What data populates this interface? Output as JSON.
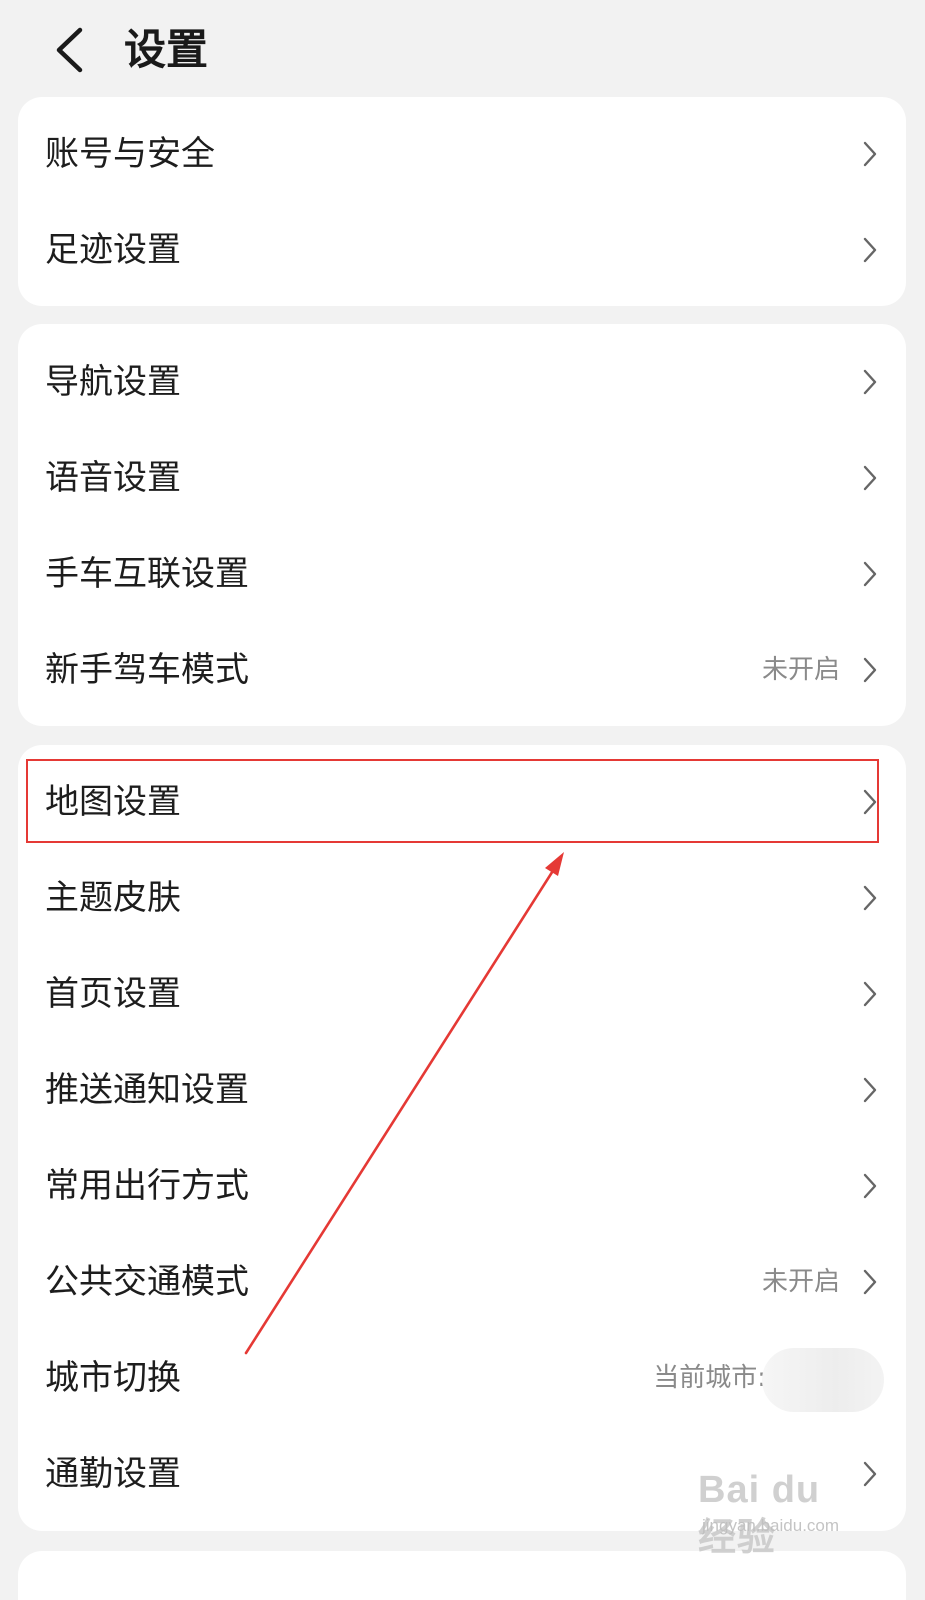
{
  "header": {
    "title": "设置",
    "back_icon": "chevron-left-icon"
  },
  "groups": [
    {
      "items": [
        {
          "label": "账号与安全"
        },
        {
          "label": "足迹设置"
        }
      ]
    },
    {
      "items": [
        {
          "label": "导航设置"
        },
        {
          "label": "语音设置"
        },
        {
          "label": "手车互联设置"
        },
        {
          "label": "新手驾车模式",
          "value": "未开启"
        }
      ]
    },
    {
      "items": [
        {
          "label": "地图设置"
        },
        {
          "label": "主题皮肤"
        },
        {
          "label": "首页设置"
        },
        {
          "label": "推送通知设置"
        },
        {
          "label": "常用出行方式"
        },
        {
          "label": "公共交通模式",
          "value": "未开启"
        },
        {
          "label": "城市切换",
          "value": "当前城市: "
        },
        {
          "label": "通勤设置"
        }
      ]
    }
  ],
  "annotation": {
    "highlight_color": "#e53935"
  },
  "watermark": {
    "main": "Bai du 经验",
    "sub": "jingyan.baidu.com"
  }
}
